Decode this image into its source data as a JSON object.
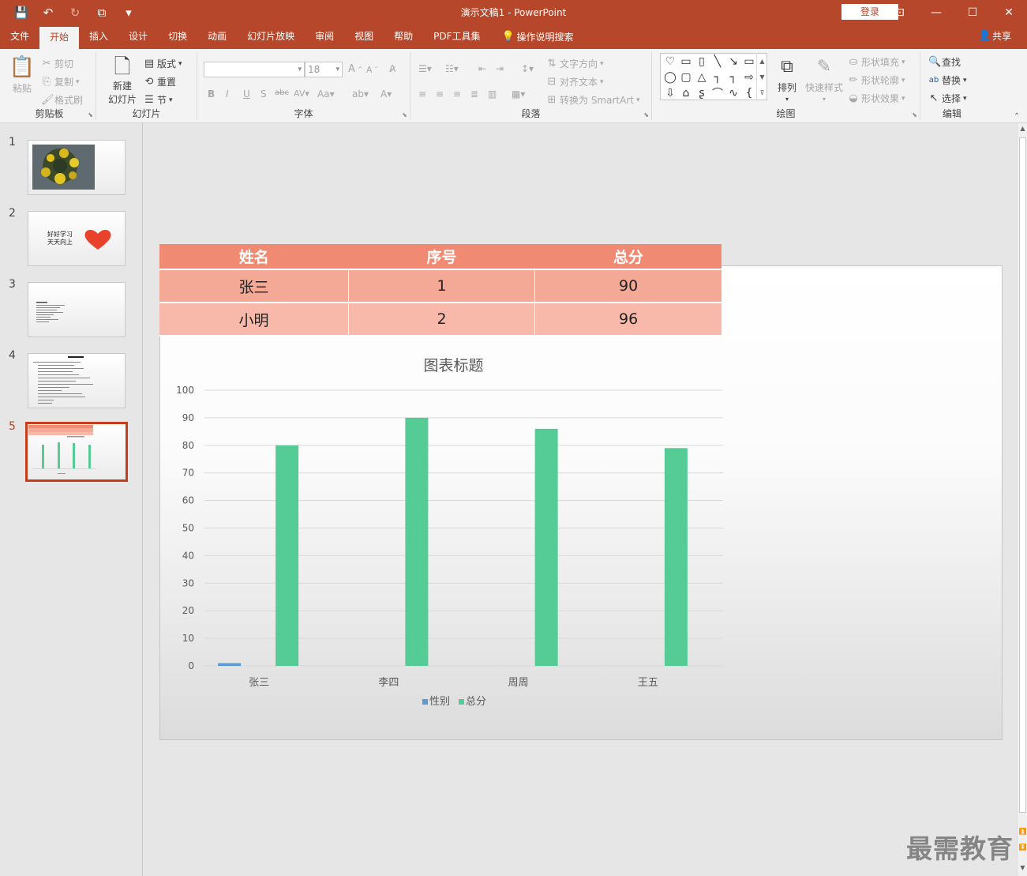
{
  "window": {
    "doc_title": "演示文稿1  -  PowerPoint",
    "login": "登录"
  },
  "tabs": [
    "文件",
    "开始",
    "插入",
    "设计",
    "切换",
    "动画",
    "幻灯片放映",
    "审阅",
    "视图",
    "帮助",
    "PDF工具集"
  ],
  "tellme": "操作说明搜索",
  "share": "共享",
  "ribbon": {
    "clipboard": {
      "label": "剪贴板",
      "paste": "粘贴",
      "cut": "剪切",
      "copy": "复制",
      "painter": "格式刷"
    },
    "slides": {
      "label": "幻灯片",
      "new_slide_1": "新建",
      "new_slide_2": "幻灯片",
      "layout": "版式",
      "reset": "重置",
      "section": "节"
    },
    "font": {
      "label": "字体",
      "size": "18"
    },
    "paragraph": {
      "label": "段落",
      "text_direction": "文字方向",
      "align_text": "对齐文本",
      "smartart": "转换为 SmartArt"
    },
    "drawing": {
      "label": "绘图",
      "arrange": "排列",
      "quick_styles": "快速样式",
      "fill": "形状填充",
      "outline": "形状轮廓",
      "effects": "形状效果"
    },
    "editing": {
      "label": "编辑",
      "find": "查找",
      "replace": "替换",
      "select": "选择"
    }
  },
  "thumbnails": {
    "numbers": [
      "1",
      "2",
      "3",
      "4",
      "5"
    ],
    "slide2_text_1": "好好学习",
    "slide2_text_2": "天天向上"
  },
  "table": {
    "headers": [
      "姓名",
      "序号",
      "总分"
    ],
    "rows": [
      [
        "张三",
        "1",
        "90"
      ],
      [
        "小明",
        "2",
        "96"
      ]
    ]
  },
  "chart_data": {
    "type": "bar",
    "title": "图表标题",
    "categories": [
      "张三",
      "李四",
      "周周",
      "王五"
    ],
    "series": [
      {
        "name": "性别",
        "values": [
          1,
          0,
          0,
          0
        ],
        "color": "#5b9bd5"
      },
      {
        "name": "总分",
        "values": [
          80,
          90,
          86,
          79
        ],
        "color": "#55cc96"
      }
    ],
    "ylim": [
      0,
      100
    ],
    "yticks": [
      0,
      10,
      20,
      30,
      40,
      50,
      60,
      70,
      80,
      90,
      100
    ],
    "grid": true,
    "legend": "bottom"
  },
  "watermark": "最需教育"
}
